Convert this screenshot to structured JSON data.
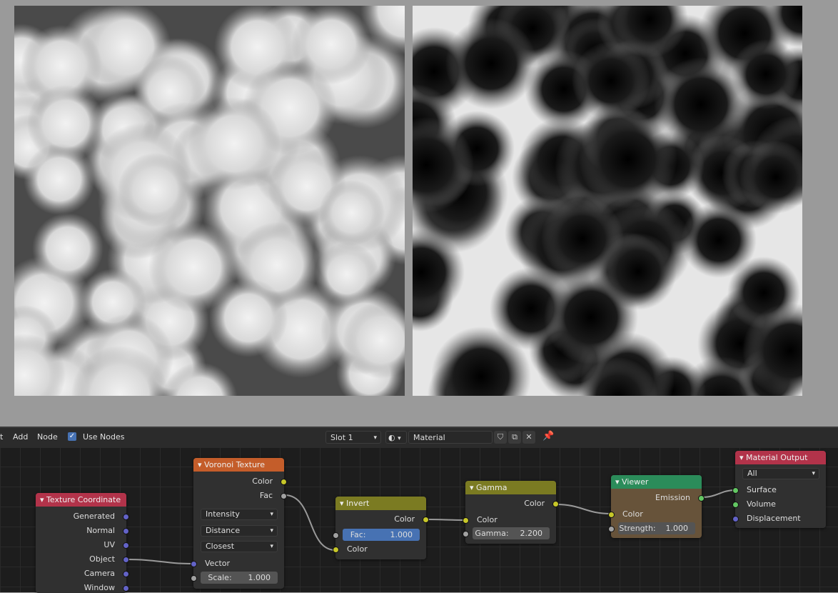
{
  "header": {
    "menu_t": "t",
    "menu_add": "Add",
    "menu_node": "Node",
    "use_nodes_label": "Use Nodes",
    "slot": "Slot 1",
    "material_name": "Material"
  },
  "nodes": {
    "texcoord": {
      "title": "Texture Coordinate",
      "outputs": [
        "Generated",
        "Normal",
        "UV",
        "Object",
        "Camera",
        "Window"
      ]
    },
    "voronoi": {
      "title": "Voronoi Texture",
      "out_color": "Color",
      "out_fac": "Fac",
      "dd1": "Intensity",
      "dd2": "Distance",
      "dd3": "Closest",
      "in_vector": "Vector",
      "scale_label": "Scale:",
      "scale_value": "1.000"
    },
    "invert": {
      "title": "Invert",
      "out_color": "Color",
      "fac_label": "Fac:",
      "fac_value": "1.000",
      "in_color": "Color"
    },
    "gamma": {
      "title": "Gamma",
      "out_color": "Color",
      "in_color": "Color",
      "gamma_label": "Gamma:",
      "gamma_value": "2.200"
    },
    "viewer": {
      "title": "Viewer",
      "out_emission": "Emission",
      "in_color": "Color",
      "strength_label": "Strength:",
      "strength_value": "1.000"
    },
    "output": {
      "title": "Material Output",
      "target": "All",
      "in_surface": "Surface",
      "in_volume": "Volume",
      "in_displacement": "Displacement"
    }
  },
  "colors": {
    "texcoord_header": "#b2334a",
    "voronoi_header": "#c45d2a",
    "invert_header": "#7b7b22",
    "gamma_header": "#7b7b22",
    "viewer_header": "#2b8c5a",
    "output_header": "#b2334a",
    "viewer_body": "#67533a"
  },
  "icons": [
    "checkbox-icon",
    "material-sphere-icon",
    "shield-icon",
    "copy-icon",
    "close-icon",
    "pin-icon",
    "chevron-down-icon"
  ]
}
